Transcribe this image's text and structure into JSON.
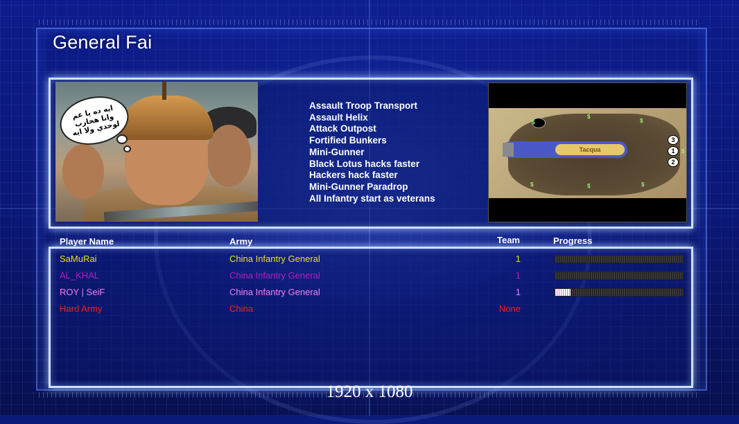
{
  "header": {
    "title": "General Fai"
  },
  "portrait": {
    "speech_bubble": "ايه ده يا عم\nوانا هحارب\nلوحدي ولا ايه"
  },
  "upgrades": [
    "Assault Troop Transport",
    "Assault Helix",
    "Attack Outpost",
    "Fortified Bunkers",
    "Mini-Gunner",
    "Black Lotus hacks faster",
    "Hackers hack faster",
    "Mini-Gunner Paradrop",
    "All Infantry start as veterans"
  ],
  "minimap": {
    "start_positions": [
      "3",
      "1",
      "2"
    ],
    "map_label": "Tacqua"
  },
  "table": {
    "headers": {
      "player": "Player Name",
      "army": "Army",
      "team": "Team",
      "progress": "Progress"
    },
    "rows": [
      {
        "name": "SaMuRai",
        "army": "China Infantry General",
        "team": "1",
        "color": "#e8e020",
        "progress": 0,
        "show_progress": true
      },
      {
        "name": "AL_KHAL",
        "army": "China Infantry General",
        "team": "1",
        "color": "#b020c0",
        "progress": 0,
        "show_progress": true
      },
      {
        "name": "ROY | SeiF",
        "army": "China Infantry General",
        "team": "1",
        "color": "#f080f0",
        "progress": 0.12,
        "show_progress": true
      },
      {
        "name": "Hard Army",
        "army": "China",
        "team": "None",
        "color": "#ff1a1a",
        "progress": null,
        "show_progress": false
      }
    ]
  },
  "footer": {
    "resolution": "1920 x 1080"
  }
}
